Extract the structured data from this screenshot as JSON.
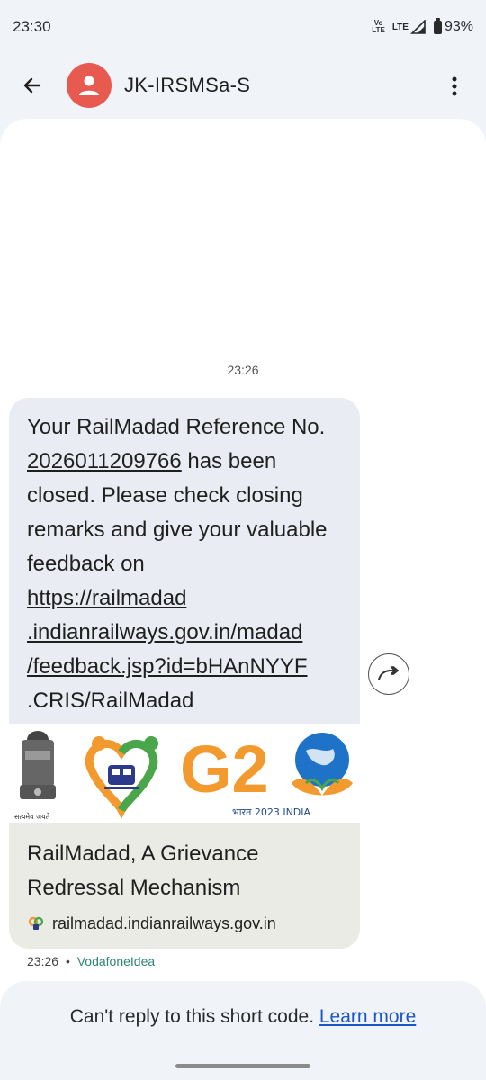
{
  "status_bar": {
    "time": "23:30",
    "net_tag_top": "Vo",
    "net_tag_mid": "LTE",
    "lte_label": "LTE",
    "battery": "93%"
  },
  "header": {
    "contact": "JK-IRSMSa-S",
    "back_icon": "arrow-back-icon",
    "more_icon": "more-vert-icon",
    "avatar_icon": "person-icon",
    "avatar_color": "#e8594f"
  },
  "conversation": {
    "time_divider": "23:26",
    "message": {
      "line1": "Your RailMadad Reference No.",
      "ref_no": "2026011209766",
      "after_ref": " has been closed. Please check closing remarks and give your valuable feedback on",
      "link_parts": [
        "https://railmadad",
        ".indianrailways.gov.in/madad",
        "/feedback.jsp?id=bHAnNYYF"
      ],
      "tail": ".CRIS/RailMadad",
      "preview": {
        "emblem_caption": "सत्यमेव जयते",
        "g20_text": "G2",
        "g20_caption": "भारत 2023 INDIA",
        "title": "RailMadad, A Grievance Redressal Mechanism",
        "domain": "railmadad.indianrailways.gov.in"
      },
      "meta_time": "23:26",
      "meta_sep": "•",
      "meta_carrier": "VodafoneIdea"
    }
  },
  "footer": {
    "text": "Can't reply to this short code.",
    "learn_more": "Learn more"
  },
  "colors": {
    "accent_link": "#1a56c9",
    "carrier": "#2c8579",
    "bubble": "#e9ecf2"
  }
}
